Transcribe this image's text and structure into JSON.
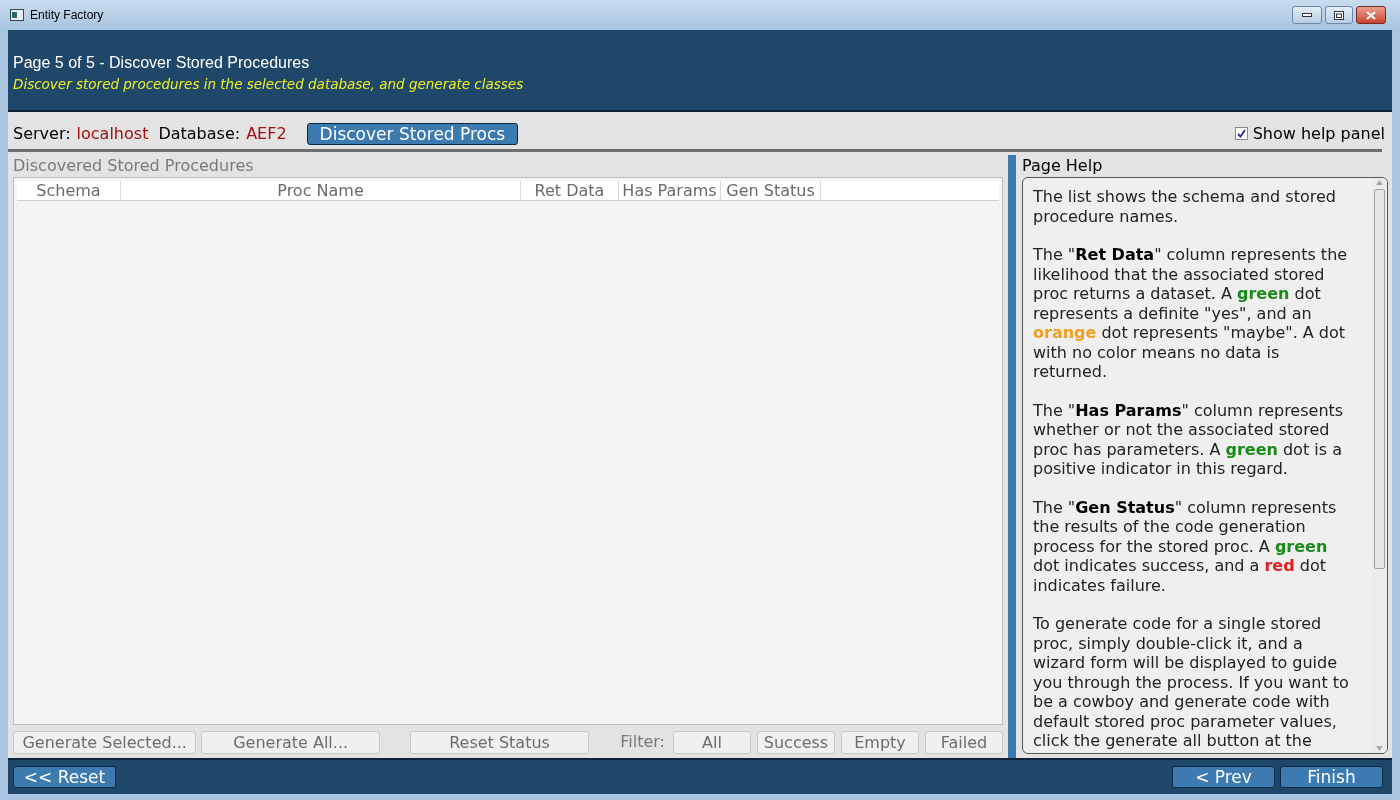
{
  "window": {
    "title": "Entity Factory"
  },
  "header": {
    "title": "Page 5 of 5 - Discover Stored Procedures",
    "subtitle": "Discover stored procedures in the selected database, and generate classes"
  },
  "toolbar": {
    "server_label": "Server:",
    "server": "localhost",
    "database_label": "Database:",
    "database": "AEF2",
    "discover_button": "Discover Stored Procs",
    "help_toggle": {
      "label": "Show help panel",
      "checked": true
    }
  },
  "list": {
    "title": "Discovered Stored Procedures",
    "columns": [
      "Schema",
      "Proc Name",
      "Ret Data",
      "Has Params",
      "Gen Status"
    ]
  },
  "actions": [
    "Generate Selected...",
    "Generate All...",
    "Reset Status"
  ],
  "filter": {
    "label": "Filter:",
    "options": [
      "All",
      "Success",
      "Empty",
      "Failed"
    ]
  },
  "help": {
    "title": "Page Help",
    "paragraphs": [
      [
        {
          "kind": "text",
          "text": "The list shows the schema and stored procedure names."
        }
      ],
      [
        {
          "kind": "text",
          "text": "The \""
        },
        {
          "kind": "term",
          "text": "Ret Data"
        },
        {
          "kind": "text",
          "text": "\" column represents the likelihood that the associated stored proc returns a dataset. A "
        },
        {
          "kind": "colored",
          "text": "green",
          "color": "#1a8a1a"
        },
        {
          "kind": "text",
          "text": " dot represents a definite \"yes\", and an "
        },
        {
          "kind": "colored",
          "text": "orange",
          "color": "#f0a020"
        },
        {
          "kind": "text",
          "text": " dot represents \"maybe\". A dot with no color means no data is returned."
        }
      ],
      [
        {
          "kind": "text",
          "text": "The \""
        },
        {
          "kind": "term",
          "text": "Has Params"
        },
        {
          "kind": "text",
          "text": "\" column represents whether or not the associated stored proc has parameters. A "
        },
        {
          "kind": "colored",
          "text": "green",
          "color": "#1a8a1a"
        },
        {
          "kind": "text",
          "text": " dot is a positive indicator in this regard."
        }
      ],
      [
        {
          "kind": "text",
          "text": "The \""
        },
        {
          "kind": "term",
          "text": "Gen Status"
        },
        {
          "kind": "text",
          "text": "\" column represents the results of the code generation process for the stored proc. A "
        },
        {
          "kind": "colored",
          "text": "green",
          "color": "#1a8a1a"
        },
        {
          "kind": "text",
          "text": " dot indicates success, and a "
        },
        {
          "kind": "colored",
          "text": "red",
          "color": "#e02020"
        },
        {
          "kind": "text",
          "text": " dot indicates failure."
        }
      ],
      [
        {
          "kind": "text",
          "text": "To generate code for a single stored proc, simply double-click it, and a wizard form will be displayed to guide you through the process. If you want to be a cowboy and generate code with default stored proc parameter values, click the generate all button at the"
        }
      ]
    ]
  },
  "footer": {
    "reset_button": "<< Reset",
    "prev_button": "< Prev",
    "finish_button": "Finish"
  }
}
